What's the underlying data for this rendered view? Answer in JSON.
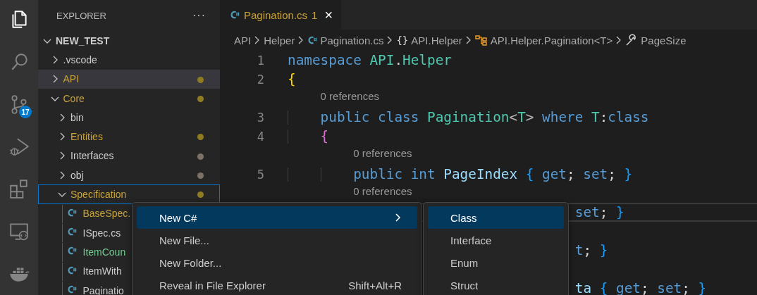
{
  "activity_bar": [
    {
      "kind": "files",
      "selected": true
    },
    {
      "kind": "search",
      "selected": false
    },
    {
      "kind": "source-control",
      "selected": false,
      "badge": "17"
    },
    {
      "kind": "run-debug",
      "selected": false
    },
    {
      "kind": "extensions",
      "selected": false
    },
    {
      "kind": "remote",
      "selected": false
    },
    {
      "kind": "docker",
      "selected": false
    }
  ],
  "sidebar": {
    "title": "EXPLORER",
    "more": "···",
    "tree": {
      "name": "NEW_TEST",
      "kind": "root",
      "expanded": true,
      "color": "#cccccc",
      "selected": false,
      "hovered": false,
      "children": [
        {
          "name": ".vscode",
          "kind": "folder",
          "expanded": false,
          "color": "#cccccc",
          "selected": false,
          "hovered": false
        },
        {
          "name": "API",
          "kind": "folder",
          "expanded": false,
          "color": "#c9a23a",
          "dot": {
            "color": "#8f7b22"
          },
          "selected": false,
          "hovered": true
        },
        {
          "name": "Core",
          "kind": "folder",
          "expanded": true,
          "color": "#c9a23a",
          "dot": {
            "color": "#8f7b22"
          },
          "selected": false,
          "hovered": false,
          "children": [
            {
              "name": "bin",
              "kind": "folder",
              "expanded": false,
              "color": "#cccccc",
              "selected": false,
              "hovered": false
            },
            {
              "name": "Entities",
              "kind": "folder",
              "expanded": false,
              "color": "#c9a23a",
              "dot": {
                "color": "#8f7b22"
              },
              "selected": false,
              "hovered": false
            },
            {
              "name": "Interfaces",
              "kind": "folder",
              "expanded": false,
              "color": "#cccccc",
              "dot": {
                "color": "#7d7265"
              },
              "selected": false,
              "hovered": false
            },
            {
              "name": "obj",
              "kind": "folder",
              "expanded": false,
              "color": "#cccccc",
              "dot": {
                "color": "#7d7265"
              },
              "selected": false,
              "hovered": false
            },
            {
              "name": "Specification",
              "kind": "folder",
              "expanded": true,
              "color": "#c9a23a",
              "dot": {
                "color": "#8f7b22"
              },
              "selected": true,
              "hovered": false,
              "children": [
                {
                  "name": "BaseSpec.",
                  "kind": "file",
                  "color": "#c9a23a",
                  "selected": false,
                  "hovered": false
                },
                {
                  "name": "ISpec.cs",
                  "kind": "file",
                  "color": "#cccccc",
                  "selected": false,
                  "hovered": false
                },
                {
                  "name": "ItemCoun",
                  "kind": "file",
                  "color": "#73c991",
                  "selected": false,
                  "hovered": false
                },
                {
                  "name": "ItemWith",
                  "kind": "file",
                  "color": "#cccccc",
                  "selected": false,
                  "hovered": false
                },
                {
                  "name": "Paginatio",
                  "kind": "file",
                  "color": "#cccccc",
                  "selected": false,
                  "hovered": false
                }
              ]
            }
          ]
        }
      ]
    }
  },
  "editor": {
    "tabs": [
      {
        "label": "Pagination.cs",
        "problems": "1",
        "close": "×",
        "selected": true
      }
    ],
    "breadcrumbs": [
      {
        "label": "API",
        "kind": "folder"
      },
      {
        "label": "Helper",
        "kind": "folder"
      },
      {
        "label": "Pagination.cs",
        "kind": "file"
      },
      {
        "label": "API.Helper",
        "kind": "namespace",
        "symbol": "{}"
      },
      {
        "label": "API.Helper.Pagination<T>",
        "kind": "class"
      },
      {
        "label": "PageSize",
        "kind": "property"
      }
    ],
    "rows": [
      {
        "kind": "line",
        "number": "1",
        "current": false,
        "tokens": [
          {
            "text": "namespace ",
            "kind": "keyword"
          },
          {
            "text": "API",
            "kind": "type"
          },
          {
            "text": ".",
            "kind": "plain"
          },
          {
            "text": "Helper",
            "kind": "type"
          }
        ]
      },
      {
        "kind": "line",
        "number": "2",
        "current": false,
        "tokens": [
          {
            "text": "{",
            "kind": "brace1"
          }
        ]
      },
      {
        "kind": "codelens",
        "text": "0 references"
      },
      {
        "kind": "line",
        "number": "3",
        "current": false,
        "tokens": [
          {
            "text": "public class ",
            "kind": "keyword"
          },
          {
            "text": "Pagination",
            "kind": "type"
          },
          {
            "text": "<",
            "kind": "punct"
          },
          {
            "text": "T",
            "kind": "type"
          },
          {
            "text": ">",
            "kind": "punct"
          },
          {
            "text": " where ",
            "kind": "keyword"
          },
          {
            "text": "T",
            "kind": "type"
          },
          {
            "text": ":",
            "kind": "plain"
          },
          {
            "text": "class",
            "kind": "keyword"
          }
        ]
      },
      {
        "kind": "line",
        "number": "4",
        "current": false,
        "tokens": [
          {
            "text": "{",
            "kind": "brace2"
          }
        ]
      },
      {
        "kind": "codelens",
        "text": "0 references"
      },
      {
        "kind": "line",
        "number": "5",
        "current": false,
        "tokens": [
          {
            "text": "public int ",
            "kind": "keyword"
          },
          {
            "text": "PageIndex ",
            "kind": "member"
          },
          {
            "text": "{",
            "kind": "brace3"
          },
          {
            "text": " get",
            "kind": "keyword"
          },
          {
            "text": "; ",
            "kind": "plain"
          },
          {
            "text": "set",
            "kind": "keyword"
          },
          {
            "text": "; ",
            "kind": "plain"
          },
          {
            "text": "}",
            "kind": "brace3"
          }
        ]
      },
      {
        "kind": "codelens",
        "text": "0 references"
      },
      {
        "kind": "partial",
        "current": true,
        "tokens": [
          {
            "text": "set",
            "kind": "keyword"
          },
          {
            "text": "; ",
            "kind": "plain"
          },
          {
            "text": "}",
            "kind": "brace3"
          }
        ]
      },
      {
        "kind": "partial",
        "current": false,
        "tokens": [
          {
            "text": "t",
            "kind": "keyword"
          },
          {
            "text": "; ",
            "kind": "plain"
          },
          {
            "text": "}",
            "kind": "brace3"
          }
        ]
      },
      {
        "kind": "partial",
        "current": false,
        "tokens": [
          {
            "text": "ta ",
            "kind": "member"
          },
          {
            "text": "{",
            "kind": "brace3"
          },
          {
            "text": " get",
            "kind": "keyword"
          },
          {
            "text": "; ",
            "kind": "plain"
          },
          {
            "text": "set",
            "kind": "keyword"
          },
          {
            "text": "; ",
            "kind": "plain"
          },
          {
            "text": "}",
            "kind": "brace3"
          }
        ]
      }
    ]
  },
  "context_menu": {
    "items": [
      {
        "label": "New C#",
        "selected": true,
        "submenu": true
      },
      {
        "label": "New File...",
        "selected": false,
        "submenu": false
      },
      {
        "label": "New Folder...",
        "selected": false,
        "submenu": false
      },
      {
        "label": "Reveal in File Explorer",
        "shortcut": "Shift+Alt+R",
        "selected": false,
        "submenu": false
      }
    ]
  },
  "submenu": {
    "items": [
      {
        "label": "Class",
        "selected": true
      },
      {
        "label": "Interface",
        "selected": false
      },
      {
        "label": "Enum",
        "selected": false
      },
      {
        "label": "Struct",
        "selected": false
      }
    ]
  }
}
